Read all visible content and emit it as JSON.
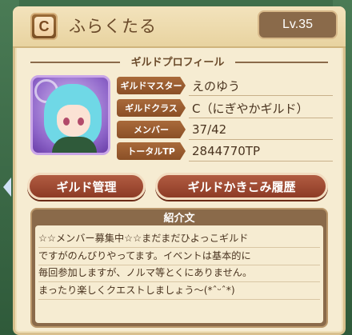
{
  "guild": {
    "rank_letter": "C",
    "name": "ふらくたる",
    "level": "Lv.35"
  },
  "profile": {
    "section_title": "ギルドプロフィール",
    "rows": [
      {
        "label": "ギルドマスター",
        "value": "えのゆう"
      },
      {
        "label": "ギルドクラス",
        "value": "C（にぎやかギルド）"
      },
      {
        "label": "メンバー",
        "value": "37/42"
      },
      {
        "label": "トータルTP",
        "value": "2844770TP"
      }
    ]
  },
  "buttons": {
    "manage": "ギルド管理",
    "history": "ギルドかきこみ履歴"
  },
  "intro": {
    "title": "紹介文",
    "text": "☆☆メンバー募集中☆☆まだまだひよっこギルド\nですがのんびりやってます。イベントは基本的に\n毎回参加しますが、ノルマ等とくにありません。\nまったり楽しくクエストしましょう〜(*ˆᵕˆ*)"
  },
  "colors": {
    "panel_bg": "#f6ecd2",
    "label_brown": "#8a4f26",
    "button_red": "#8d3b26",
    "background_green": "#3f6e4a"
  },
  "icons": {
    "rank_badge": "rank-c-badge-icon",
    "side_arrow": "chevron-left-icon"
  }
}
